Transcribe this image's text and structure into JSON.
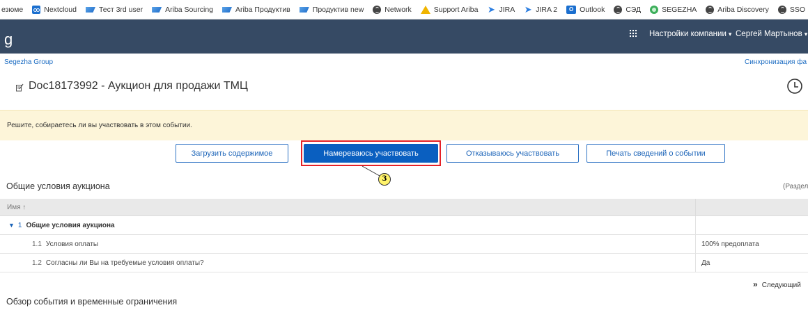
{
  "bookmarks": [
    {
      "label": "езюме",
      "icon": "none"
    },
    {
      "label": "Nextcloud",
      "icon": "nextcloud-icon"
    },
    {
      "label": "Тест 3rd user",
      "icon": "sap-icon"
    },
    {
      "label": "Ariba Sourcing",
      "icon": "sap-icon"
    },
    {
      "label": "Ariba Продуктив",
      "icon": "sap-icon"
    },
    {
      "label": "Продуктив new",
      "icon": "sap-icon"
    },
    {
      "label": "Network",
      "icon": "globe-icon"
    },
    {
      "label": "Support Ariba",
      "icon": "warning-icon"
    },
    {
      "label": "JIRA",
      "icon": "jira-icon"
    },
    {
      "label": "JIRA 2",
      "icon": "jira-icon"
    },
    {
      "label": "Outlook",
      "icon": "outlook-icon"
    },
    {
      "label": "СЭД",
      "icon": "globe-icon"
    },
    {
      "label": "SEGEZHA",
      "icon": "segezha-icon"
    },
    {
      "label": "Ariba Discovery",
      "icon": "globe-icon"
    },
    {
      "label": "SSO",
      "icon": "globe-icon"
    }
  ],
  "header": {
    "logo_fragment": "g",
    "company_settings": "Настройки компании",
    "user_name": "Сергей Мартынов",
    "caret": "▾",
    "colors": {
      "bar": "#364a64"
    }
  },
  "breadcrumb": {
    "company": "Segezha Group",
    "sync_link": "Синхронизация фа"
  },
  "page": {
    "title": "Doc18173992 - Аукцион для продажи ТМЦ"
  },
  "notice": {
    "text": "Решите, собираетесь ли вы участвовать в этом событии."
  },
  "actions": {
    "upload": "Загрузить содержимое",
    "intend": "Намереваюсь участвовать",
    "decline": "Отказываюсь участвовать",
    "print": "Печать сведений о событии",
    "step_number": "3",
    "colors": {
      "primary": "#0a5fc0",
      "highlight": "#e52127",
      "badge": "#fff36b"
    }
  },
  "section": {
    "title": "Общие условия аукциона",
    "right_label": "(Раздел :"
  },
  "table": {
    "header_name": "Имя ↑",
    "rows": [
      {
        "num": "1",
        "label": "Общие условия аукциона",
        "value": "",
        "group": true
      },
      {
        "num": "1.1",
        "label": "Условия оплаты",
        "value": "100% предоплата",
        "group": false
      },
      {
        "num": "1.2",
        "label": "Согласны ли Вы на требуемые условия оплаты?",
        "value": "Да",
        "group": false
      }
    ]
  },
  "pagination": {
    "next_symbol": "»",
    "next_label": "Следующий"
  },
  "section2": {
    "title": "Обзор события и временные ограничения"
  }
}
